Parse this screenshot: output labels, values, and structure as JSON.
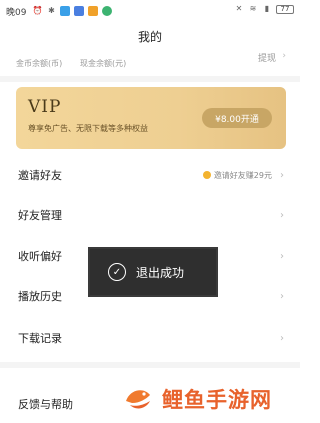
{
  "status_bar": {
    "time": "晚09",
    "battery": "77",
    "icons": [
      "alarm-icon",
      "bluetooth-icon",
      "app-icon-1",
      "app-icon-2",
      "app-icon-3",
      "app-icon-4",
      "mute-icon",
      "wifi-icon",
      "signal-icon",
      "battery-icon"
    ]
  },
  "header": {
    "title": "我的"
  },
  "balance": {
    "gold_label": "金币余额(币)",
    "cash_label": "现金余额(元)",
    "withdraw_label": "提现"
  },
  "vip": {
    "title": "VIP",
    "description": "尊享免广告、无限下载等多种权益",
    "button_label": "¥8.00开通"
  },
  "menu": {
    "invite": {
      "label": "邀请好友",
      "hint": "邀请好友赚29元"
    },
    "friends": {
      "label": "好友管理"
    },
    "listening": {
      "label": "收听偏好"
    },
    "history": {
      "label": "播放历史"
    },
    "downloads": {
      "label": "下载记录"
    },
    "feedback": {
      "label": "反馈与帮助"
    }
  },
  "toast": {
    "message": "退出成功"
  },
  "watermark": {
    "text": "鲤鱼手游网"
  },
  "colors": {
    "vip_gradient_start": "#f3d69a",
    "vip_button": "#c8a665",
    "watermark": "#e8622c",
    "toast_bg": "#2f2f2f"
  }
}
